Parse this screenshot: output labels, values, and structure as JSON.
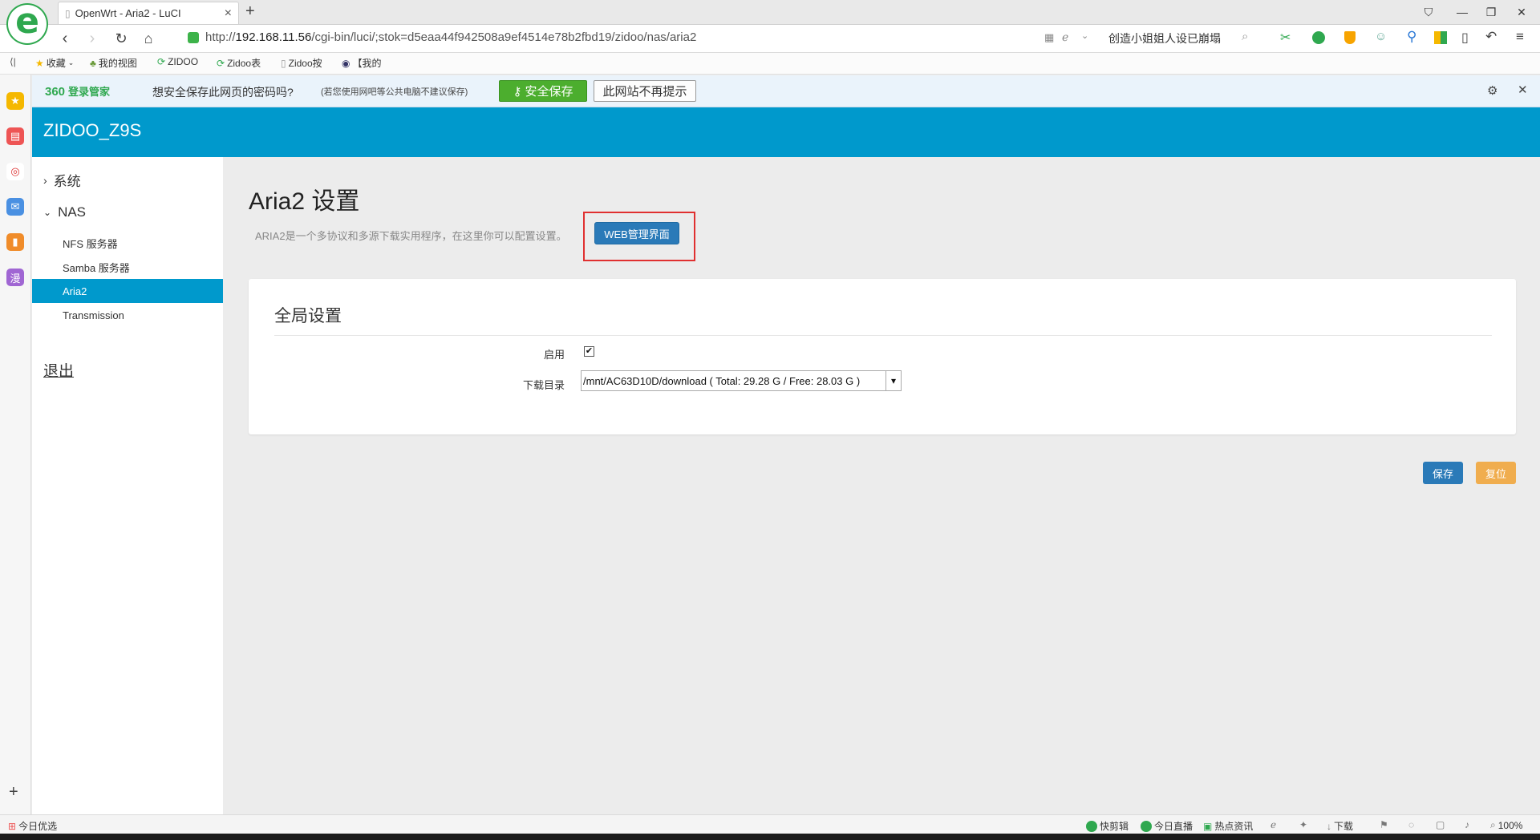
{
  "browser": {
    "tab_title": "OpenWrt - Aria2 - LuCI",
    "tab_close": "×",
    "new_tab": "+",
    "url_prefix": "http://",
    "url_host": "192.168.11.56",
    "url_path": "/cgi-bin/luci/;stok=d5eaa44f942508a9ef4514e78b2fbd19/zidoo/nas/aria2",
    "search_text": "创造小姐姐人设已崩塌",
    "bookmarks": [
      {
        "label": "收藏",
        "icon": "star-icon"
      },
      {
        "label": "我的视图",
        "icon": "tree-icon"
      },
      {
        "label": "ZIDOO",
        "icon": "zidoo-icon"
      },
      {
        "label": "Zidoo表",
        "icon": "zidoo-icon"
      },
      {
        "label": "Zidoo按",
        "icon": "page-icon"
      },
      {
        "label": "【我的",
        "icon": "badge-icon"
      }
    ]
  },
  "password_bar": {
    "brand": "360",
    "brand_suffix": "登录管家",
    "question": "想安全保存此网页的密码吗?",
    "note": "(若您使用网吧等公共电脑不建议保存)",
    "save_label": "安全保存",
    "dismiss_label": "此网站不再提示"
  },
  "app": {
    "brand": "ZIDOO_Z9S"
  },
  "nav": {
    "system": "系统",
    "nas": "NAS",
    "items": [
      "NFS 服务器",
      "Samba 服务器",
      "Aria2",
      "Transmission"
    ],
    "logout": "退出"
  },
  "main": {
    "title": "Aria2 设置",
    "description": "ARIA2是一个多协议和多源下载实用程序，在这里你可以配置设置。",
    "web_button": "WEB管理界面",
    "section_title": "全局设置",
    "enable_label": "启用",
    "enable_checked": true,
    "download_dir_label": "下载目录",
    "download_dir_value": "/mnt/AC63D10D/download ( Total: 29.28 G / Free: 28.03 G )",
    "save_button": "保存",
    "reset_button": "复位"
  },
  "statusbar": {
    "left": "今日优选",
    "items": [
      "快剪辑",
      "今日直播",
      "热点资讯",
      "下载"
    ],
    "zoom": "100%"
  },
  "colors": {
    "header": "#0099cc",
    "save": "#2a7ab8",
    "reset": "#f0ad4e",
    "highlight": "#e03030"
  }
}
